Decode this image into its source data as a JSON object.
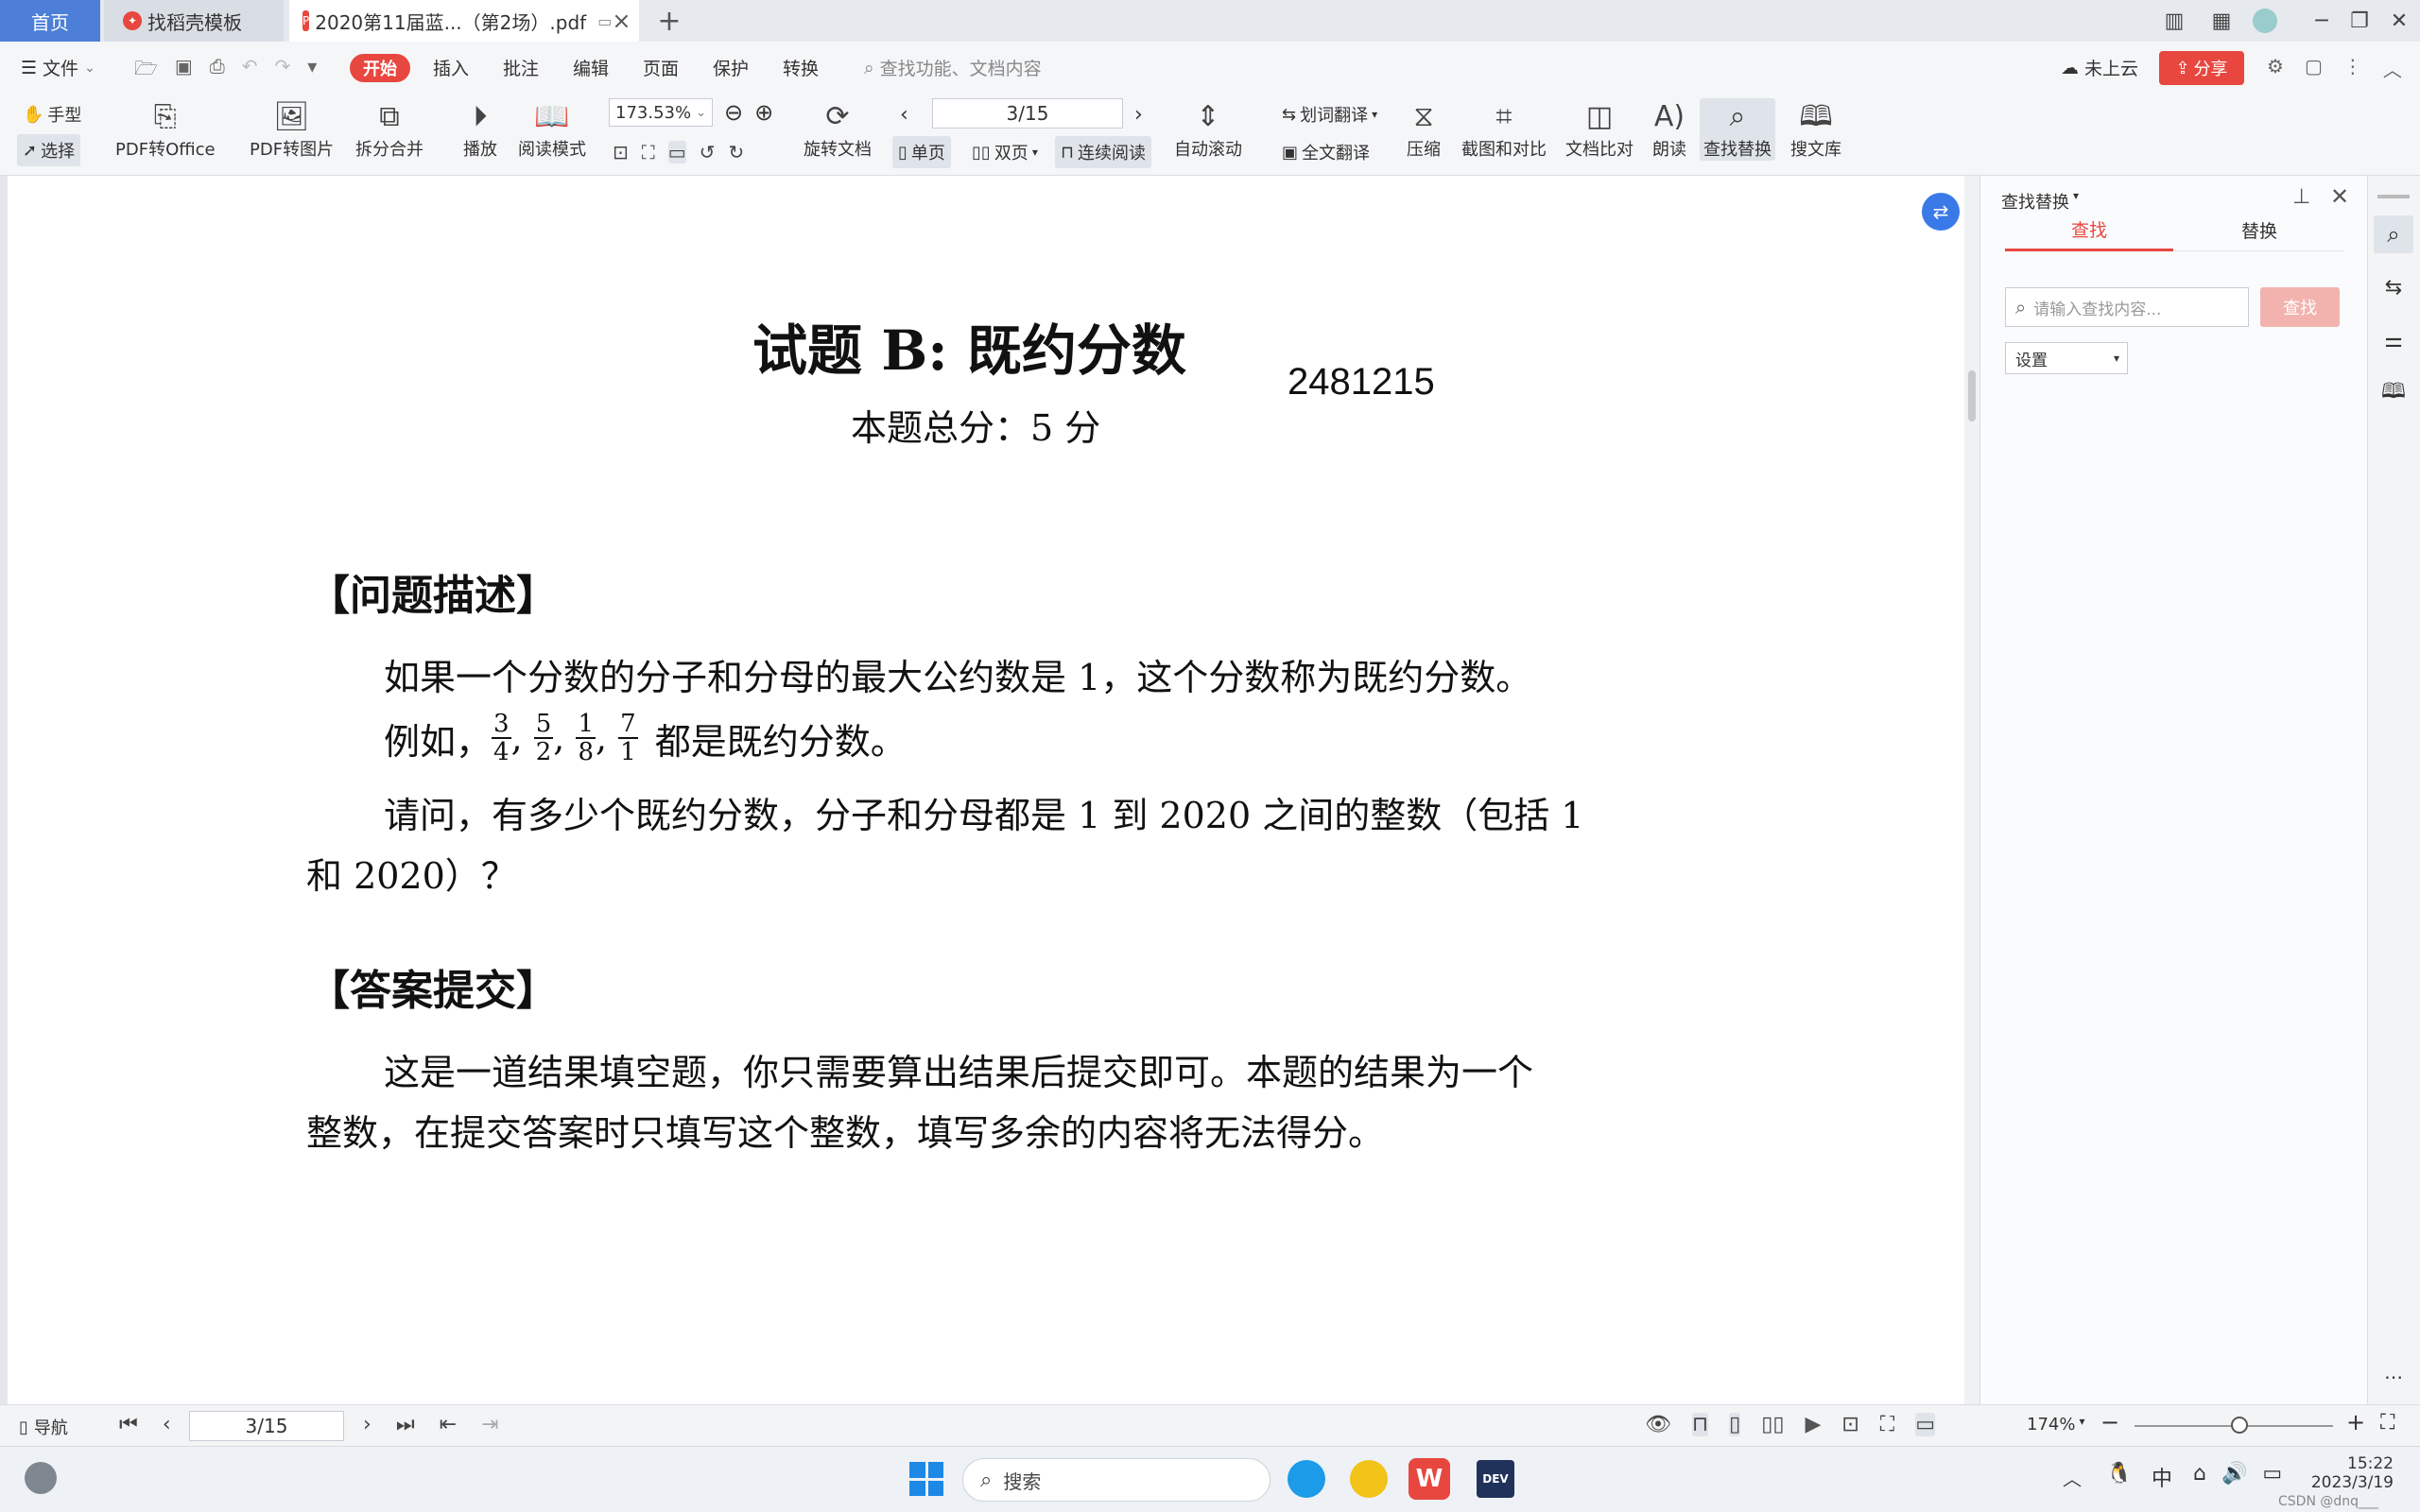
{
  "tabs": {
    "home": "首页",
    "template": "找稻壳模板",
    "pdf": "2020第11届蓝...（第2场）.pdf"
  },
  "menu": {
    "file": "文件",
    "start": "开始",
    "items": [
      "插入",
      "批注",
      "编辑",
      "页面",
      "保护",
      "转换"
    ],
    "search_placeholder": "查找功能、文档内容",
    "cloud": "未上云",
    "share": "分享"
  },
  "toolbar": {
    "hand": "手型",
    "select": "选择",
    "pdf_to_office": "PDF转Office",
    "pdf_to_image": "PDF转图片",
    "split_merge": "拆分合并",
    "play": "播放",
    "read_mode": "阅读模式",
    "zoom_value": "173.53%",
    "rotate_doc": "旋转文档",
    "page_value": "3/15",
    "single_page": "单页",
    "double_page": "双页",
    "continuous": "连续阅读",
    "auto_scroll": "自动滚动",
    "word_translate": "划词翻译",
    "full_translate": "全文翻译",
    "compress": "压缩",
    "screenshot_compare": "截图和对比",
    "doc_compare": "文档比对",
    "read_aloud": "朗读",
    "find_replace": "查找替换",
    "search_library": "搜文库"
  },
  "document": {
    "title": "试题 B: 既约分数",
    "stamp": "2481215",
    "score": "本题总分：5 分",
    "section1": "【问题描述】",
    "p1": "如果一个分数的分子和分母的最大公约数是 1，这个分数称为既约分数。",
    "p2_prefix": "例如，",
    "fractions": [
      {
        "num": "3",
        "den": "4"
      },
      {
        "num": "5",
        "den": "2"
      },
      {
        "num": "1",
        "den": "8"
      },
      {
        "num": "7",
        "den": "1"
      }
    ],
    "p2_suffix": "都是既约分数。",
    "p3_line1": "请问，有多少个既约分数，分子和分母都是 1 到 2020 之间的整数（包括 1",
    "p3_line2": "和 2020）？",
    "section2": "【答案提交】",
    "p4_line1": "这是一道结果填空题，你只需要算出结果后提交即可。本题的结果为一个",
    "p4_line2": "整数，在提交答案时只填写这个整数，填写多余的内容将无法得分。"
  },
  "panel": {
    "title": "查找替换",
    "tab_find": "查找",
    "tab_replace": "替换",
    "input_placeholder": "请输入查找内容...",
    "find_button": "查找",
    "settings": "设置"
  },
  "statusbar": {
    "nav": "导航",
    "page_value": "3/15",
    "zoom": "174%"
  },
  "taskbar": {
    "search": "搜索",
    "ime": "中",
    "time": "15:22",
    "date": "2023/3/19",
    "watermark": "CSDN @dnq___"
  },
  "colors": {
    "accent": "#e8473f",
    "home_tab": "#4d7fd8"
  }
}
